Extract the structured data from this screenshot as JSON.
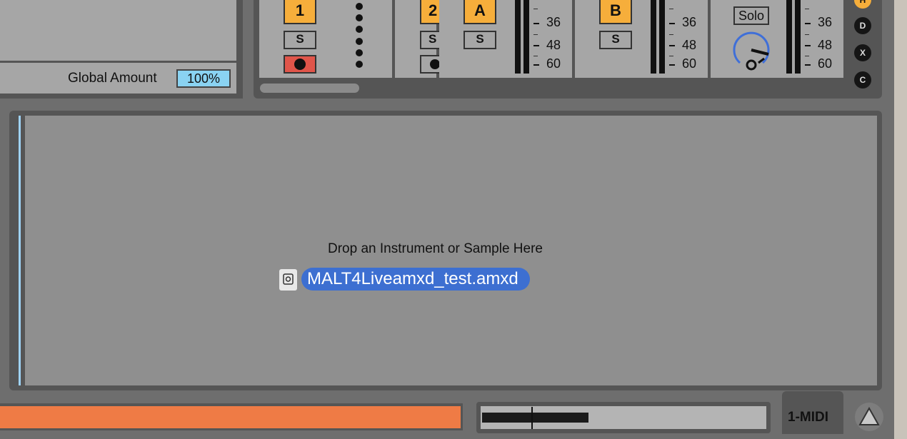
{
  "macro": {
    "global_amount_label": "Global Amount",
    "global_amount_value": "100%"
  },
  "mixer": {
    "track1": {
      "number": "1",
      "solo": "S"
    },
    "track2": {
      "number": "2",
      "solo": "S"
    },
    "return_a": {
      "letter": "A",
      "solo": "S"
    },
    "return_b": {
      "letter": "B",
      "solo": "S"
    },
    "master": {
      "solo_label": "Solo"
    },
    "meter_ticks": [
      "36",
      "48",
      "60"
    ],
    "side_buttons": [
      "H",
      "D",
      "X",
      "C"
    ]
  },
  "device": {
    "drop_hint": "Drop an Instrument or Sample Here",
    "dragged_file": "MALT4Liveamxd_test.amxd"
  },
  "status": {
    "track_name": "1-MIDI"
  },
  "colors": {
    "track_button": "#f6ae3b",
    "record_button": "#e0554a",
    "selection": "#3d6fd1",
    "clip_bar": "#ef7b45",
    "amount_field": "#8ad3f2"
  }
}
